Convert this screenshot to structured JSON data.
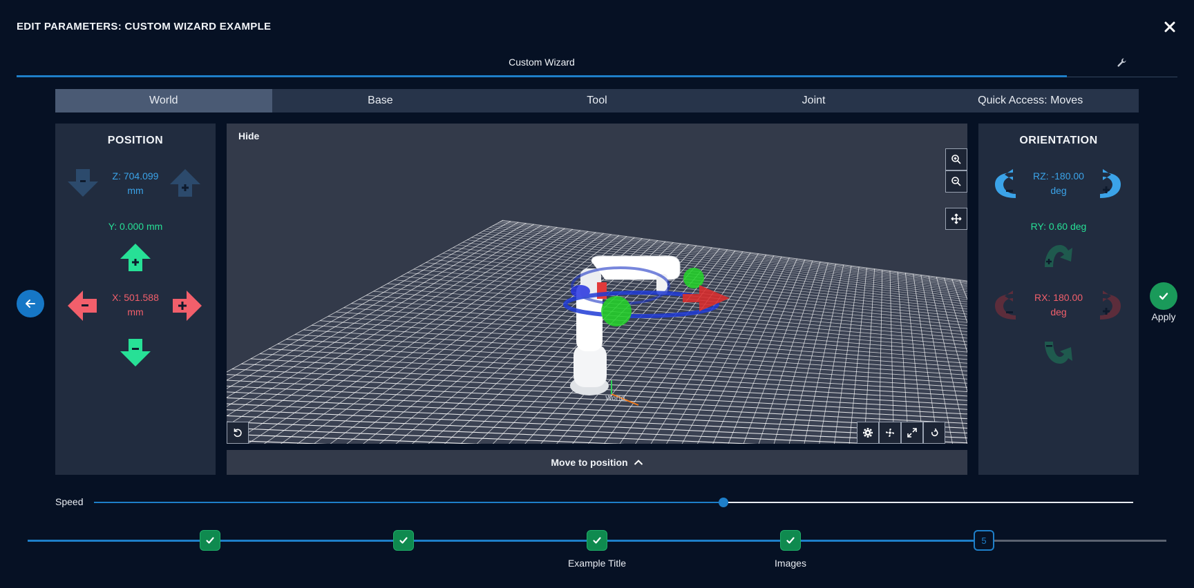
{
  "header": {
    "title": "EDIT PARAMETERS: CUSTOM WIZARD EXAMPLE"
  },
  "top_tabs": {
    "main": "Custom Wizard"
  },
  "frame_tabs": [
    "World",
    "Base",
    "Tool",
    "Joint",
    "Quick Access: Moves"
  ],
  "position": {
    "title": "POSITION",
    "z_value": "Z: 704.099",
    "z_unit": "mm",
    "y_value": "Y: 0.000 mm",
    "x_value": "X: 501.588",
    "x_unit": "mm"
  },
  "orientation": {
    "title": "ORIENTATION",
    "rz_value": "RZ: -180.00",
    "rz_unit": "deg",
    "ry_value": "RY: 0.60 deg",
    "rx_value": "RX: 180.00",
    "rx_unit": "deg"
  },
  "viewport": {
    "hide_label": "Hide",
    "world_label": "World"
  },
  "move_bar": {
    "label": "Move to position"
  },
  "apply": {
    "label": "Apply"
  },
  "speed": {
    "label": "Speed",
    "fraction": 0.606
  },
  "stepper": {
    "steps": [
      {
        "state": "done",
        "label": ""
      },
      {
        "state": "done",
        "label": ""
      },
      {
        "state": "done",
        "label": "Example Title"
      },
      {
        "state": "done",
        "label": "Images"
      },
      {
        "state": "current",
        "number": "5",
        "label": ""
      }
    ]
  },
  "colors": {
    "background": "#061124",
    "accent": "#1e7fc9",
    "z_axis": "#3ba3e8",
    "y_axis": "#27e096",
    "x_axis": "#f25f6b",
    "success": "#0f8a4f"
  }
}
